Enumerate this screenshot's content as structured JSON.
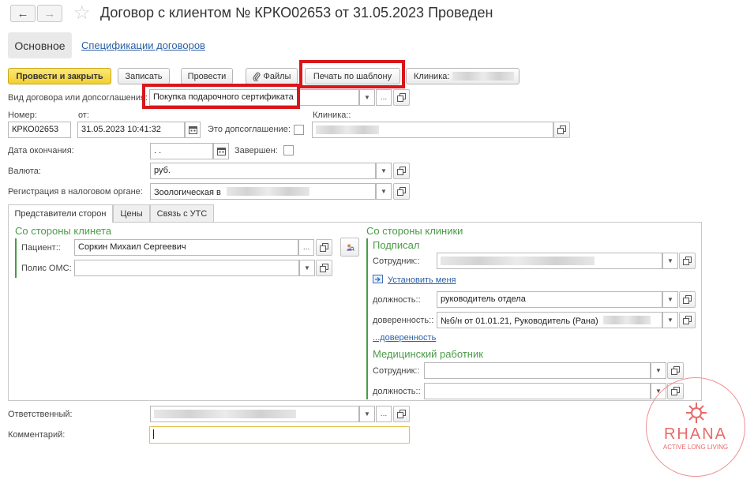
{
  "header": {
    "title": "Договор с клиентом № КРКО02653 от 31.05.2023 Проведен",
    "back_glyph": "←",
    "forward_glyph": "→",
    "star_glyph": "☆"
  },
  "tabs_top": {
    "main": "Основное",
    "specs": "Спецификации договоров"
  },
  "toolbar": {
    "post_close": "Провести и закрыть",
    "save": "Записать",
    "post": "Провести",
    "files": "Файлы",
    "print_template": "Печать по шаблону",
    "clinic_label": "Клиника:"
  },
  "form": {
    "contract_type_label": "Вид договора или допсоглашения:",
    "contract_type_value": "Покупка подарочного сертификата",
    "number_label": "Номер:",
    "number_value": "КРКО02653",
    "from_label": "от:",
    "from_value": "31.05.2023 10:41:32",
    "addendum_label": "Это допсоглашение:",
    "clinic_label": "Клиника::",
    "end_date_label": "Дата окончания:",
    "end_date_value": " .  .",
    "completed_label": "Завершен:",
    "currency_label": "Валюта:",
    "currency_value": "руб.",
    "tax_label": "Регистрация в налоговом органе:",
    "tax_value": "Зоологическая в"
  },
  "inner_tabs": [
    "Представители сторон",
    "Цены",
    "Связь с УТС"
  ],
  "client_side": {
    "title": "Со стороны клинета",
    "patient_label": "Пациент::",
    "patient_value": "Соркин Михаил Сергеевич",
    "oms_label": "Полис ОМС:"
  },
  "clinic_side": {
    "title": "Со стороны клиники",
    "signed_title": "Подписал",
    "employee_label": "Сотрудник::",
    "set_me_link": "Установить меня",
    "position_label": "должность::",
    "position_value": "руководитель отдела",
    "proxy_label": "доверенность::",
    "proxy_value": "№б/н от 01.01.21, Руководитель (Рана)",
    "proxy_link": "...доверенность",
    "medic_title": "Медицинский работник",
    "medic_employee_label": "Сотрудник::",
    "medic_position_label": "должность::"
  },
  "footer": {
    "responsible_label": "Ответственный:",
    "comment_label": "Комментарий:"
  },
  "watermark": {
    "brand": "RHANA",
    "tagline": "ACTIVE LONG LIVING",
    "color": "#e86a6a"
  },
  "colors": {
    "highlight": "#d8161b",
    "group_title": "#4a9b47",
    "link": "#2b5fa6",
    "primary_button": "#f2cf31"
  }
}
